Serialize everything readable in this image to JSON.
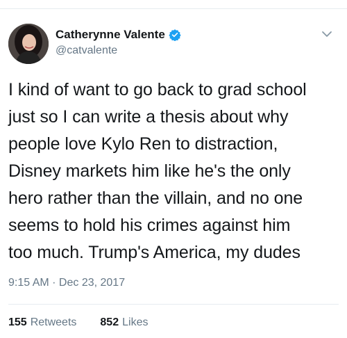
{
  "author": {
    "display_name": "Catherynne Valente",
    "handle": "@catvalente",
    "verified": true,
    "verified_color": "#1da1f2"
  },
  "tweet": {
    "text": "I kind of want to go back to grad school\njust so I can write a thesis about why\npeople love Kylo Ren to distraction,\nDisney markets him like he's the only\nhero rather than the villain, and no one\nseems to hold his crimes against him\ntoo much. Trump's America, my dudes",
    "timestamp": "9:15 AM · Dec 23, 2017"
  },
  "stats": {
    "retweets_count": "155",
    "retweets_label": "Retweets",
    "likes_count": "852",
    "likes_label": "Likes"
  },
  "icons": {
    "verified": "verified-badge-icon",
    "menu": "chevron-down-icon"
  }
}
